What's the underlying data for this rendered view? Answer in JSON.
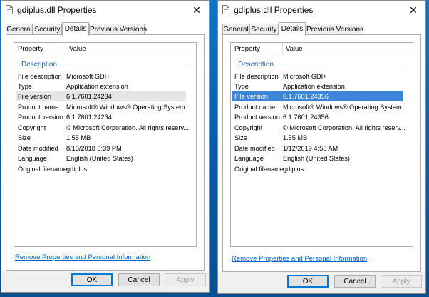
{
  "windows": [
    {
      "title": "gdiplus.dll Properties",
      "tabs": [
        "General",
        "Security",
        "Details",
        "Previous Versions"
      ],
      "active_tab": "Details",
      "columns": {
        "property": "Property",
        "value": "Value"
      },
      "group": "Description",
      "rows": [
        {
          "name": "File description",
          "value": "Microsoft GDI+"
        },
        {
          "name": "Type",
          "value": "Application extension"
        },
        {
          "name": "File version",
          "value": "6.1.7601.24234",
          "selected": "gray"
        },
        {
          "name": "Product name",
          "value": "Microsoft® Windows® Operating System"
        },
        {
          "name": "Product version",
          "value": "6.1.7601.24234"
        },
        {
          "name": "Copyright",
          "value": "© Microsoft Corporation. All rights reserv..."
        },
        {
          "name": "Size",
          "value": "1.55 MB"
        },
        {
          "name": "Date modified",
          "value": "8/13/2018 6:39 PM"
        },
        {
          "name": "Language",
          "value": "English (United States)"
        },
        {
          "name": "Original filename",
          "value": "gdiplus"
        }
      ],
      "link": "Remove Properties and Personal Information",
      "buttons": {
        "ok": "OK",
        "cancel": "Cancel",
        "apply": "Apply"
      }
    },
    {
      "title": "gdiplus.dll Properties",
      "tabs": [
        "General",
        "Security",
        "Details",
        "Previous Versions"
      ],
      "active_tab": "Details",
      "columns": {
        "property": "Property",
        "value": "Value"
      },
      "group": "Description",
      "rows": [
        {
          "name": "File description",
          "value": "Microsoft GDI+"
        },
        {
          "name": "Type",
          "value": "Application extension"
        },
        {
          "name": "File version",
          "value": "6.1.7601.24356",
          "selected": "blue"
        },
        {
          "name": "Product name",
          "value": "Microsoft® Windows® Operating System"
        },
        {
          "name": "Product version",
          "value": "6.1.7601.24356"
        },
        {
          "name": "Copyright",
          "value": "© Microsoft Corporation. All rights reserv..."
        },
        {
          "name": "Size",
          "value": "1.55 MB"
        },
        {
          "name": "Date modified",
          "value": "1/12/2019 4:55 AM"
        },
        {
          "name": "Language",
          "value": "English (United States)"
        },
        {
          "name": "Original filename",
          "value": "gdiplus"
        }
      ],
      "link": "Remove Properties and Personal Information",
      "buttons": {
        "ok": "OK",
        "cancel": "Cancel",
        "apply": "Apply"
      }
    }
  ],
  "icons": {
    "app": "document-icon",
    "close": "close-icon"
  },
  "colors": {
    "selection_blue": "#3b86d8",
    "selection_gray": "#e5e5e5",
    "link": "#0066cc",
    "group_label": "#1b5fb0"
  }
}
